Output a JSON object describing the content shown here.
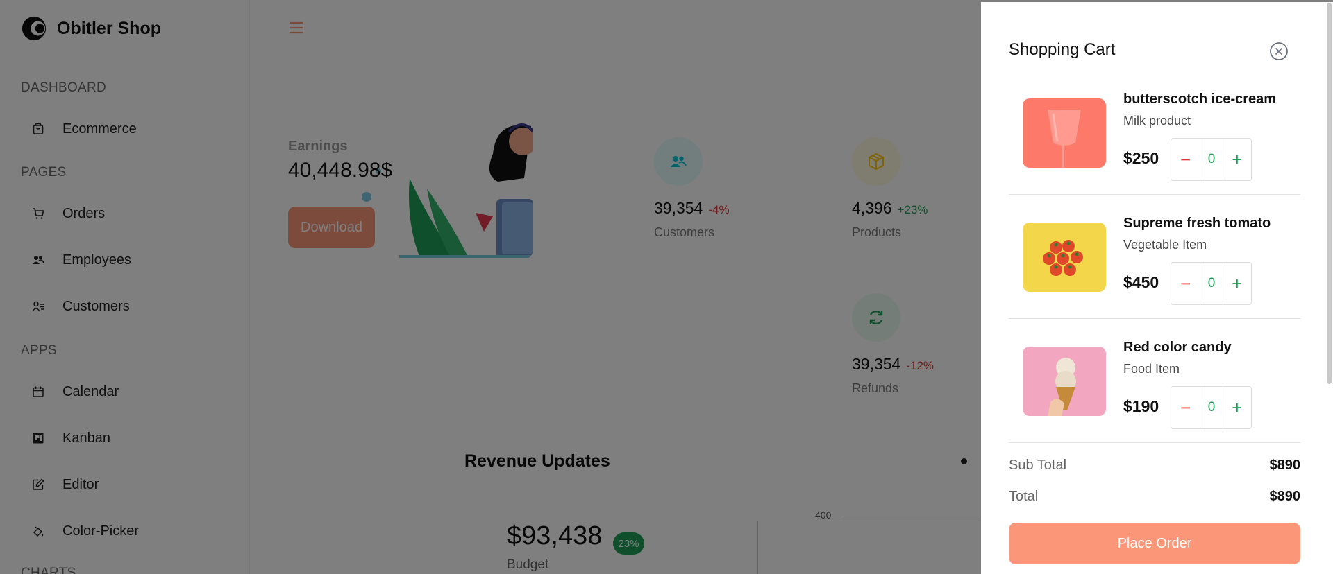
{
  "brand": {
    "name": "Obitler Shop",
    "logo_icon": "brand-logo-icon"
  },
  "sidebar": {
    "sections": {
      "dashboard": "DASHBOARD",
      "pages": "PAGES",
      "apps": "APPS",
      "charts": "CHARTS"
    },
    "items": [
      {
        "label": "Ecommerce",
        "icon": "shopping-bag-icon"
      },
      {
        "label": "Orders",
        "icon": "cart-icon"
      },
      {
        "label": "Employees",
        "icon": "employees-icon"
      },
      {
        "label": "Customers",
        "icon": "customers-icon"
      },
      {
        "label": "Calendar",
        "icon": "calendar-icon"
      },
      {
        "label": "Kanban",
        "icon": "kanban-icon"
      },
      {
        "label": "Editor",
        "icon": "editor-icon"
      },
      {
        "label": "Color-Picker",
        "icon": "color-picker-icon"
      }
    ]
  },
  "main": {
    "earnings": {
      "label": "Earnings",
      "value": "40,448.98$",
      "button": "Download"
    },
    "stats": [
      {
        "value": "39,354",
        "change": "-4%",
        "label": "Customers",
        "icon": "customers-icon",
        "icon_color": "#03c9d7",
        "icon_bg": "#e5fafb",
        "change_color": "#e53935"
      },
      {
        "value": "4,396",
        "change": "+23%",
        "label": "Products",
        "icon": "box-icon",
        "icon_color": "#fec90f",
        "icon_bg": "#fff8e1",
        "change_color": "#1e9e56"
      },
      {
        "value": "39,354",
        "change": "-12%",
        "label": "Refunds",
        "icon": "refresh-icon",
        "icon_color": "#1e9e56",
        "icon_bg": "#ebfaf2",
        "change_color": "#e53935"
      }
    ],
    "revenue": {
      "title": "Revenue Updates",
      "amount": "$93,438",
      "badge": "23%",
      "budget_label": "Budget",
      "y_tick": "400"
    }
  },
  "cart": {
    "title": "Shopping Cart",
    "items": [
      {
        "name": "butterscotch ice-cream",
        "category": "Milk product",
        "price": "$250",
        "qty": "0",
        "image": "ice-cream-cup-image",
        "bg": "#fd7a6a"
      },
      {
        "name": "Supreme fresh tomato",
        "category": "Vegetable Item",
        "price": "$450",
        "qty": "0",
        "image": "tomatoes-image",
        "bg": "#f3d64a"
      },
      {
        "name": "Red color candy",
        "category": "Food Item",
        "price": "$190",
        "qty": "0",
        "image": "ice-cream-cone-image",
        "bg": "#f2a6c0"
      }
    ],
    "sub_total_label": "Sub Total",
    "sub_total_value": "$890",
    "total_label": "Total",
    "total_value": "$890",
    "place_order": "Place Order"
  },
  "colors": {
    "accent": "#fb9678",
    "positive": "#1e9e56",
    "negative": "#e53935"
  }
}
